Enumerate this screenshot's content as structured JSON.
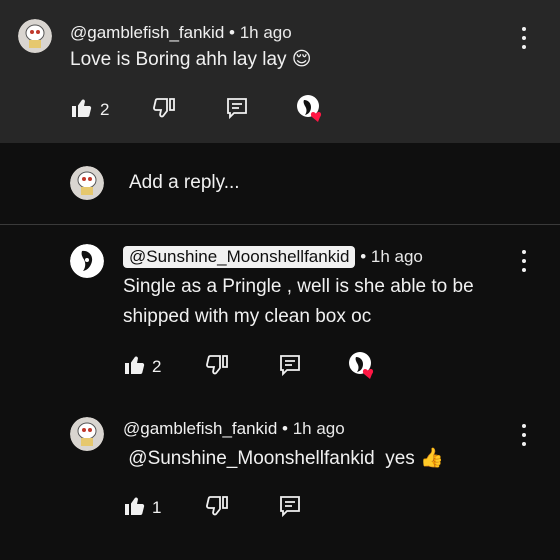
{
  "colors": {
    "panel": "#272727",
    "background": "#0f0f0f",
    "text": "#f1f1f1",
    "heart": "#ff1744"
  },
  "top_comment": {
    "author": "@gamblefish_fankid",
    "separator": "•",
    "time": "1h ago",
    "text": "Love is Boring ahh lay lay",
    "emoji": "😌",
    "like_count": "2",
    "icons": [
      "thumbs-up-icon",
      "thumbs-down-icon",
      "reply-icon",
      "creator-heart-icon",
      "more-vert-icon"
    ]
  },
  "reply_box": {
    "placeholder": "Add a reply..."
  },
  "replies": [
    {
      "author": "@Sunshine_Moonshellfankid",
      "author_highlighted": true,
      "separator": "•",
      "time": "1h ago",
      "text_line1": "Single as a Pringle , well is she able to be",
      "text_line2": "shipped with my clean box oc",
      "like_count": "2"
    },
    {
      "author": "@gamblefish_fankid",
      "separator": "•",
      "time": "1h ago",
      "mention": "@Sunshine_Moonshellfankid",
      "text": "yes",
      "emoji": "👍",
      "like_count": "1"
    }
  ]
}
